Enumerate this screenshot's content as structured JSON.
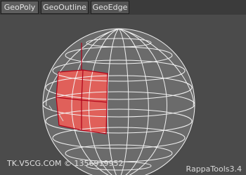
{
  "tabs": [
    {
      "label": "GeoPoly",
      "active": true
    },
    {
      "label": "GeoOutline",
      "active": false
    },
    {
      "label": "GeoEdge",
      "active": false
    }
  ],
  "viewport": {
    "mesh": "sphere",
    "wire_color": "#f2f2f2",
    "sphere_color": "#6b6b6b",
    "selected_face_color": "#e0605a",
    "selected_edge_color": "#b00018",
    "background": "#4b4b4b"
  },
  "watermark": "TK.V5CG.COM © 1356919952",
  "version_label": "RappaTools3.4"
}
